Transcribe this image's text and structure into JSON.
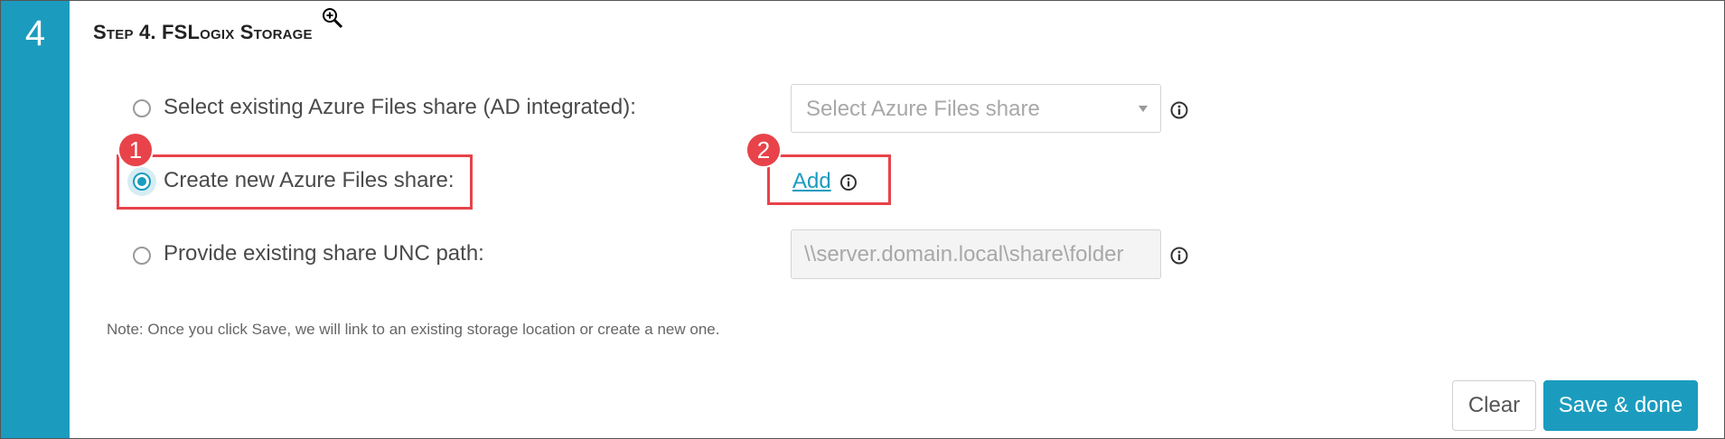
{
  "step": {
    "number": "4",
    "title": "Step 4. FSLogix Storage"
  },
  "options": [
    {
      "label": "Select existing Azure Files share (AD integrated):",
      "selected": false
    },
    {
      "label": "Create new Azure Files share:",
      "selected": true
    },
    {
      "label": "Provide existing share UNC path:",
      "selected": false
    }
  ],
  "share_select": {
    "placeholder": "Select Azure Files share"
  },
  "add_link": {
    "label": "Add"
  },
  "unc_input": {
    "placeholder": "\\\\server.domain.local\\share\\folder"
  },
  "note": "Note: Once you click Save, we will link to an existing storage location or create a new one.",
  "buttons": {
    "clear": "Clear",
    "save": "Save & done"
  },
  "callouts": [
    {
      "number": "1"
    },
    {
      "number": "2"
    }
  ],
  "colors": {
    "accent": "#1b9cbf",
    "callout": "#e8434a"
  }
}
